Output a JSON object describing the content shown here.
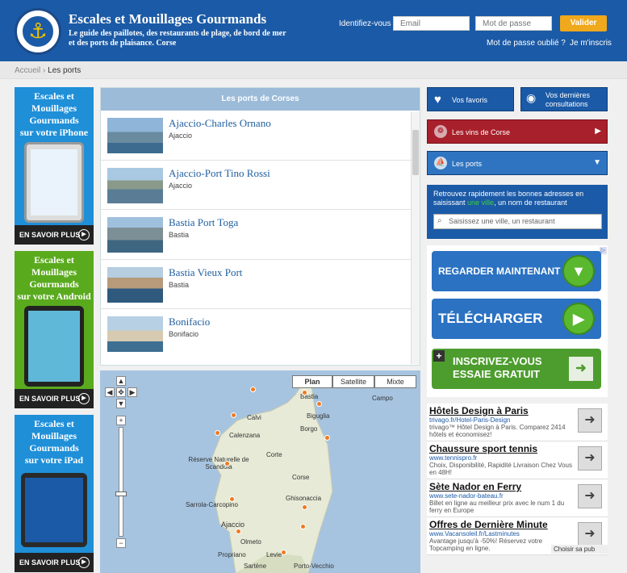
{
  "header": {
    "title": "Escales et Mouillages Gourmands",
    "subtitle": "Le guide des paillotes, des restaurants de plage, de bord de mer et des ports de plaisance. Corse",
    "login_label": "Identifiez-vous",
    "email_placeholder": "Email",
    "password_placeholder": "Mot de passe",
    "submit_label": "Valider",
    "forgot_label": "Mot de passe oublié ?",
    "signup_label": "Je m'inscris"
  },
  "breadcrumb": {
    "home": "Accueil",
    "separator": "›",
    "current": "Les ports"
  },
  "promos": [
    {
      "title": "Escales et Mouillages Gourmands",
      "platform": "iPhone",
      "button": "EN SAVOIR PLUS",
      "color": "#1f8fd8"
    },
    {
      "title": "Escales et Mouillages Gourmands",
      "platform": "Android",
      "button": "EN SAVOIR PLUS",
      "color": "#5aaa1e"
    },
    {
      "title": "Escales et Mouillages Gourmands",
      "platform": "iPad",
      "button": "EN SAVOIR PLUS",
      "color": "#1f8fd8"
    }
  ],
  "promo_prefix": "sur votre",
  "ports": {
    "heading": "Les ports de Corses",
    "items": [
      {
        "name": "Ajaccio-Charles Ornano",
        "city": "Ajaccio"
      },
      {
        "name": "Ajaccio-Port Tino Rossi",
        "city": "Ajaccio"
      },
      {
        "name": "Bastia Port Toga",
        "city": "Bastia"
      },
      {
        "name": "Bastia Vieux Port",
        "city": "Bastia"
      },
      {
        "name": "Bonifacio",
        "city": "Bonifacio"
      }
    ]
  },
  "map": {
    "types": [
      "Plan",
      "Satellite",
      "Mixte"
    ],
    "selected": "Plan",
    "labels": [
      "Bastia",
      "Campo",
      "Biguglia",
      "Calvi",
      "Calenzana",
      "Borgo",
      "Réserve Naturelle de Scandola",
      "Corte",
      "Ghisonaccia",
      "Sarrola-Carcopino",
      "Ajaccio",
      "Olmeto",
      "Porto-Vecchio",
      "Propriano",
      "Levie",
      "Sartène",
      "Corse"
    ]
  },
  "sidebar": {
    "favorites": "Vos favoris",
    "recent": "Vos dernières consultations",
    "wines": "Les vins de Corse",
    "ports": "Les ports",
    "search_text_before": "Retrouvez rapidement les bonnes adresses en saisissant",
    "search_text_highlight": "une ville",
    "search_text_after": ", un nom de restaurant",
    "search_placeholder": "Saisissez une ville, un restaurant"
  },
  "ads": {
    "banners": [
      "REGARDER MAINTENANT",
      "TÉLÉCHARGER",
      "INSCRIVEZ-VOUS ESSAIE GRATUIT"
    ],
    "text_ads": [
      {
        "title": "Hôtels Design à Paris",
        "url": "trivago.fr/Hotel-Paris-Design",
        "desc": "trivago™ Hôtel Design à Paris. Comparez 2414 hôtels et économisez!"
      },
      {
        "title": "Chaussure sport tennis",
        "url": "www.tennispro.fr",
        "desc": "Choix, Disponibilité, Rapidité Livraison Chez Vous en 48H!"
      },
      {
        "title": "Sète Nador en Ferry",
        "url": "www.sete-nador-bateau.fr",
        "desc": "Billet en ligne au meilleur prix avec le num 1 du ferry en Europe"
      },
      {
        "title": "Offres de Dernière Minute",
        "url": "www.Vacansoleil.fr/Lastminutes",
        "desc": "Avantage jusqu'à -50%! Réservez votre Topcamping en ligne."
      }
    ],
    "choice_label": "Choisir sa pub"
  }
}
